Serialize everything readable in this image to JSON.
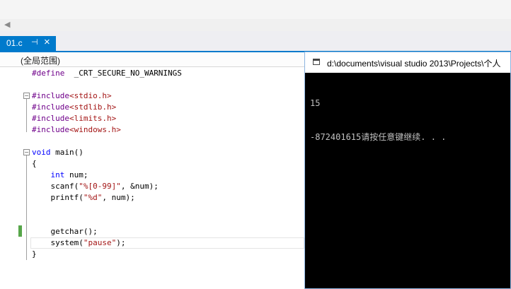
{
  "tab": {
    "name": "01.c",
    "pin_glyph": "⊣",
    "close_glyph": "×"
  },
  "scope_label": "(全局范围)",
  "code_lines": [
    {
      "parts": [
        [
          "macro",
          "#define"
        ],
        [
          "",
          "  _CRT_SECURE_NO_WARNINGS"
        ]
      ]
    },
    {
      "parts": []
    },
    {
      "parts": [
        [
          "macro",
          "#include"
        ],
        [
          "str",
          "<stdio.h>"
        ]
      ]
    },
    {
      "parts": [
        [
          "macro",
          "#include"
        ],
        [
          "str",
          "<stdlib.h>"
        ]
      ]
    },
    {
      "parts": [
        [
          "macro",
          "#include"
        ],
        [
          "str",
          "<limits.h>"
        ]
      ]
    },
    {
      "parts": [
        [
          "macro",
          "#include"
        ],
        [
          "str",
          "<windows.h>"
        ]
      ]
    },
    {
      "parts": []
    },
    {
      "parts": [
        [
          "kw",
          "void"
        ],
        [
          "",
          " main()"
        ]
      ]
    },
    {
      "parts": [
        [
          "",
          "{"
        ]
      ]
    },
    {
      "parts": [
        [
          "",
          "    "
        ],
        [
          "kw",
          "int"
        ],
        [
          "",
          " num;"
        ]
      ]
    },
    {
      "parts": [
        [
          "",
          "    scanf("
        ],
        [
          "str",
          "\"%[0-99]\""
        ],
        [
          "",
          ", &num);"
        ]
      ]
    },
    {
      "parts": [
        [
          "",
          "    printf("
        ],
        [
          "str",
          "\"%d\""
        ],
        [
          "",
          ", num);"
        ]
      ]
    },
    {
      "parts": []
    },
    {
      "parts": []
    },
    {
      "parts": [
        [
          "",
          "    getchar();"
        ]
      ]
    },
    {
      "parts": [
        [
          "",
          "    system("
        ],
        [
          "str",
          "\"pause\""
        ],
        [
          "",
          ");"
        ]
      ]
    },
    {
      "parts": [
        [
          "",
          "}"
        ]
      ]
    }
  ],
  "console": {
    "title": "d:\\documents\\visual studio 2013\\Projects\\个人",
    "lines": [
      "15",
      "-872401615请按任意键继续. . ."
    ]
  },
  "colors": {
    "accent": "#007acc",
    "keyword": "#0000ff",
    "string": "#a31515",
    "macro": "#6f008a",
    "change_marker": "#57a64a"
  }
}
